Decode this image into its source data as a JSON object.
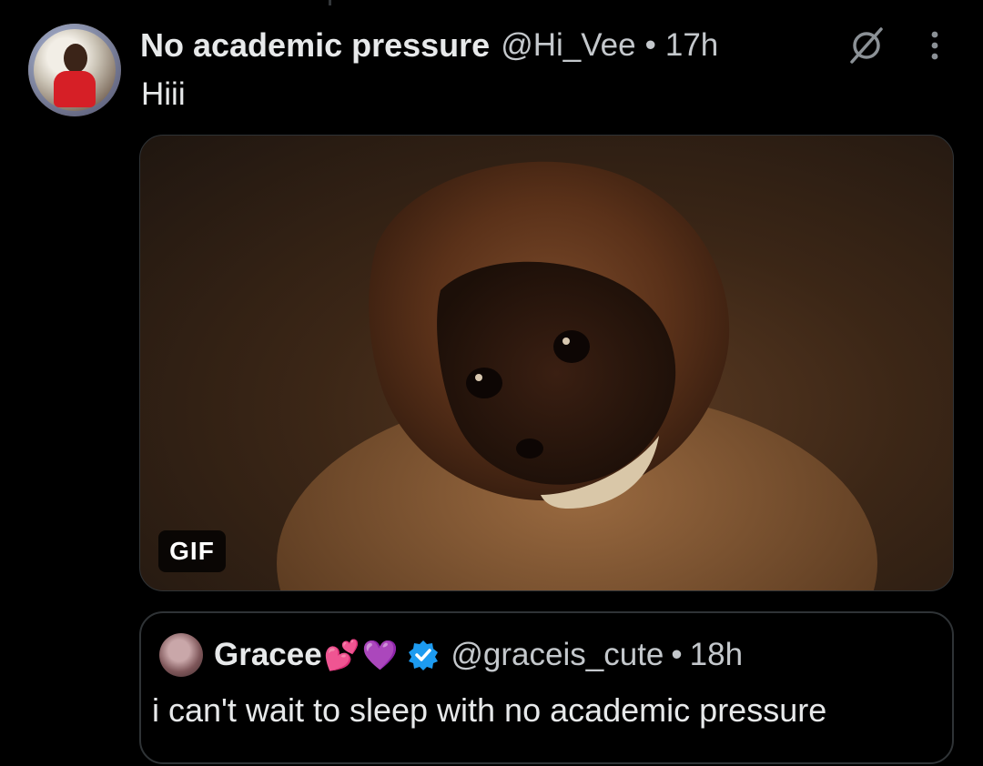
{
  "tweet": {
    "display_name": "No academic pressure",
    "handle": "@Hi_Vee",
    "separator": "•",
    "time": "17h",
    "text": "Hiii",
    "media": {
      "badge": "GIF"
    },
    "icons": {
      "grok": "grok-icon",
      "more": "more-options-icon"
    }
  },
  "quoted_tweet": {
    "display_name": "Gracee",
    "emoji_1": "💕",
    "emoji_2": "💜",
    "verified": true,
    "handle": "@graceis_cute",
    "separator": "•",
    "time": "18h",
    "text": "i can't wait to sleep with no academic pressure"
  },
  "colors": {
    "background": "#000000",
    "text_primary": "#e7e9ea",
    "text_secondary": "#c4c8cc",
    "border": "#2f3336",
    "verified": "#1d9bf0"
  }
}
